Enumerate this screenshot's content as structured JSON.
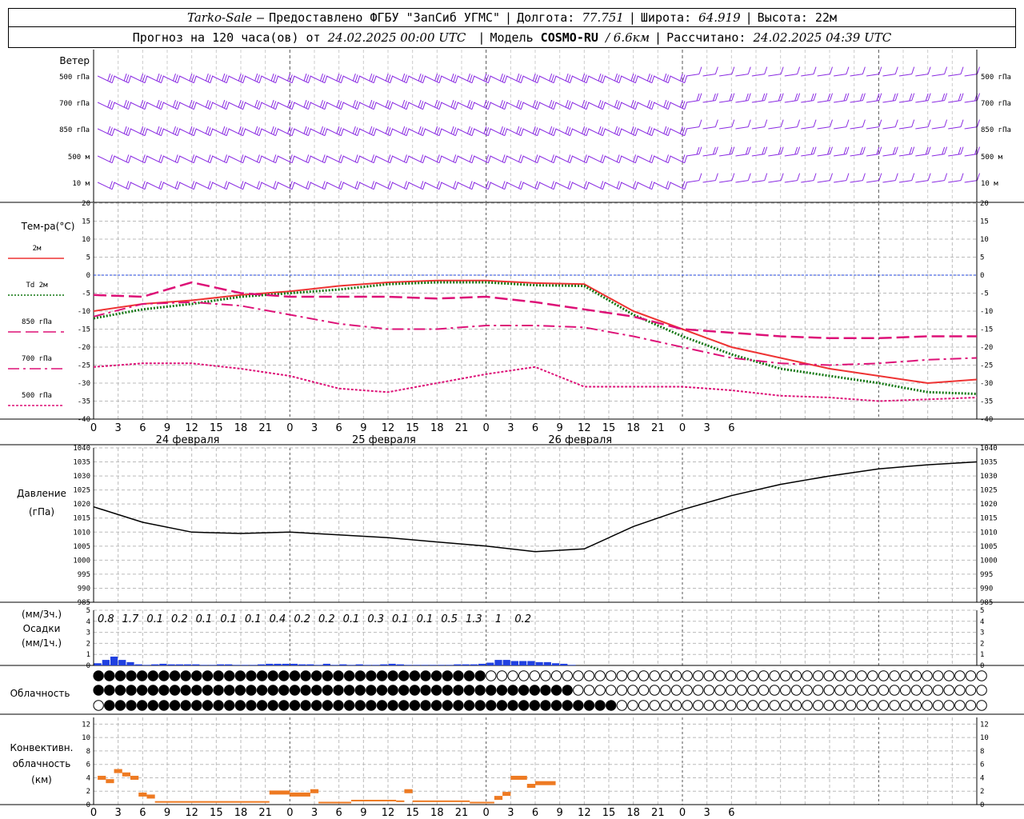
{
  "header": {
    "station": "Tarko-Sale",
    "dash": "–",
    "provider": "Предоставлено ФГБУ \"ЗапСиб УГМС\"",
    "lon_label": "Долгота:",
    "lon": "77.751",
    "lat_label": "Широта:",
    "lat": "64.919",
    "alt_label": "Высота:",
    "alt": "22м",
    "forecast_prefix": "Прогноз на 120 часа(ов) от",
    "forecast_from": "24.02.2025 00:00 UTC",
    "model_label": "Модель",
    "model": "COSMO-RU",
    "resolution": "/ 6.6км",
    "calc_label": "Рассчитано:",
    "calc_time": "24.02.2025 04:39 UTC"
  },
  "wind_panel": {
    "title": "Ветер",
    "levels": [
      "500 гПа",
      "700 гПа",
      "850 гПа",
      "500 м",
      "10  м"
    ]
  },
  "temp_panel": {
    "title": "Тем-ра(°С)",
    "legend": [
      {
        "label": "2м",
        "color": "#ee3333",
        "style": "solid"
      },
      {
        "label": "Td  2м",
        "color": "#117711",
        "style": "dotted"
      },
      {
        "label": "850 гПа",
        "color": "#dd1177",
        "style": "long-dash"
      },
      {
        "label": "700 гПа",
        "color": "#dd1177",
        "style": "dash-dot"
      },
      {
        "label": "500 гПа",
        "color": "#dd1177",
        "style": "short-dot"
      }
    ]
  },
  "pressure_panel": {
    "title": "Давление",
    "unit": "(гПа)"
  },
  "precip_panel": {
    "unit3h": "(мм/3ч.)",
    "title": "Осадки",
    "unit1h": "(мм/1ч.)",
    "totals": [
      "0.8",
      "1.7",
      "0.1",
      "0.2",
      "0.1",
      "0.1",
      "0.1",
      "0.4",
      "0.2",
      "0.2",
      "0.1",
      "0.3",
      "0.1",
      "0.1",
      "0.5",
      "1.3",
      "1",
      "0.2"
    ]
  },
  "cloud_panel": {
    "title": "Облачность"
  },
  "conv_panel": {
    "title": "Конвективн.",
    "title2": "облачность",
    "unit": "(км)"
  },
  "x_axis": {
    "hour_labels": [
      "0",
      "3",
      "6",
      "9",
      "12",
      "15",
      "18",
      "21",
      "0",
      "3",
      "6",
      "9",
      "12",
      "15",
      "18",
      "21",
      "0",
      "3",
      "6",
      "9",
      "12",
      "15",
      "18",
      "21",
      "0",
      "3",
      "6"
    ],
    "days": [
      "24 февраля",
      "25 февраля",
      "26 февраля"
    ]
  },
  "chart_data": [
    {
      "type": "line",
      "title": "Тем-ра(°С)",
      "x_hours": [
        0,
        6,
        12,
        18,
        24,
        30,
        36,
        42,
        48,
        54,
        60,
        66,
        72,
        78,
        84,
        90,
        96,
        102,
        108
      ],
      "ylim": [
        -40,
        20
      ],
      "yticks": [
        20,
        15,
        10,
        5,
        0,
        -5,
        -10,
        -15,
        -20,
        -25,
        -30,
        -35,
        -40
      ],
      "series": [
        {
          "name": "2м",
          "values": [
            -10,
            -8,
            -7,
            -5.5,
            -4.5,
            -3,
            -2,
            -1.5,
            -1.5,
            -2.2,
            -2.5,
            -10,
            -15,
            -20,
            -23,
            -26,
            -28,
            -30,
            -29
          ]
        },
        {
          "name": "Td  2м",
          "values": [
            -12,
            -9.5,
            -8,
            -6,
            -5,
            -4,
            -2.5,
            -2,
            -2,
            -2.8,
            -3,
            -11,
            -17,
            -22,
            -26,
            -28,
            -30,
            -32.5,
            -33
          ]
        },
        {
          "name": "850 гПа",
          "values": [
            -5.5,
            -6,
            -2,
            -5,
            -6,
            -6,
            -6,
            -6.5,
            -6,
            -7.5,
            -9.5,
            -11.5,
            -15,
            -16,
            -17,
            -17.5,
            -17.5,
            -17,
            -17
          ]
        },
        {
          "name": "700 гПа",
          "values": [
            -11.5,
            -8,
            -7.5,
            -8.5,
            -11,
            -13.5,
            -15,
            -15,
            -14,
            -14,
            -14.5,
            -17,
            -20,
            -23,
            -24.5,
            -25,
            -24.5,
            -23.5,
            -23
          ]
        },
        {
          "name": "500 гПа",
          "values": [
            -25.5,
            -24.5,
            -24.5,
            -26,
            -28,
            -31.5,
            -32.5,
            -30,
            -27.5,
            -25.5,
            -31,
            -31,
            -31,
            -32,
            -33.5,
            -34,
            -35,
            -34.5,
            -34
          ]
        }
      ]
    },
    {
      "type": "line",
      "title": "Давление",
      "x_hours": [
        0,
        6,
        12,
        18,
        24,
        30,
        36,
        42,
        48,
        54,
        60,
        66,
        72,
        78,
        84,
        90,
        96,
        102,
        108
      ],
      "ylim": [
        985,
        1040
      ],
      "yticks": [
        1040,
        1035,
        1030,
        1025,
        1020,
        1015,
        1010,
        1005,
        1000,
        995,
        990,
        985
      ],
      "series": [
        {
          "name": "",
          "values": [
            1019,
            1013.5,
            1010,
            1009.5,
            1010,
            1009,
            1008,
            1006.5,
            1005,
            1003,
            1004,
            1012,
            1018,
            1023,
            1027,
            1030,
            1032.5,
            1034,
            1035
          ]
        }
      ]
    },
    {
      "type": "bar",
      "title": "Осадки",
      "ylim": [
        0,
        5
      ],
      "yticks": [
        5,
        4,
        3,
        2,
        1,
        0
      ],
      "x_hours": [
        1,
        2,
        3,
        4,
        5,
        6,
        7,
        8,
        9,
        10,
        11,
        12,
        13,
        14,
        15,
        16,
        17,
        18,
        19,
        20,
        21,
        22,
        23,
        24,
        25,
        26,
        27,
        28,
        29,
        30,
        31,
        32,
        33,
        34,
        35,
        36,
        37,
        38,
        39,
        40,
        41,
        42,
        43,
        44,
        45,
        46,
        47,
        48,
        49,
        50,
        51,
        52,
        53,
        54,
        55,
        56,
        57,
        58,
        59,
        60,
        61,
        62,
        63,
        64,
        65,
        66,
        67
      ],
      "values": [
        0.2,
        0.5,
        0.8,
        0.5,
        0.3,
        0.1,
        0.05,
        0.1,
        0.15,
        0.1,
        0.1,
        0.1,
        0.1,
        0.05,
        0.05,
        0.1,
        0.1,
        0.05,
        0.05,
        0.05,
        0.1,
        0.15,
        0.15,
        0.15,
        0.15,
        0.1,
        0.1,
        0.05,
        0.15,
        0.05,
        0.1,
        0.05,
        0.1,
        0.05,
        0.05,
        0.1,
        0.15,
        0.1,
        0.05,
        0.05,
        0.05,
        0.05,
        0.05,
        0.05,
        0.1,
        0.1,
        0.1,
        0.15,
        0.25,
        0.5,
        0.5,
        0.4,
        0.4,
        0.4,
        0.3,
        0.3,
        0.2,
        0.15,
        0.05,
        0,
        0,
        0,
        0,
        0,
        0,
        0,
        0
      ]
    },
    {
      "type": "bar",
      "title": "Конвективн. облачность",
      "ylim": [
        0,
        13
      ],
      "yticks": [
        12,
        10,
        8,
        6,
        4,
        2,
        0
      ],
      "segments": [
        {
          "from": 0.5,
          "to": 1.5,
          "value": 4
        },
        {
          "from": 1.5,
          "to": 2.5,
          "value": 3.5
        },
        {
          "from": 2.5,
          "to": 3.5,
          "value": 5
        },
        {
          "from": 3.5,
          "to": 4.5,
          "value": 4.5
        },
        {
          "from": 4.5,
          "to": 5.5,
          "value": 4
        },
        {
          "from": 5.5,
          "to": 6.5,
          "value": 1.5
        },
        {
          "from": 6.5,
          "to": 7.5,
          "value": 1.2
        },
        {
          "from": 7.5,
          "to": 21.5,
          "value": 0.4
        },
        {
          "from": 21.5,
          "to": 24,
          "value": 1.8
        },
        {
          "from": 24,
          "to": 26.5,
          "value": 1.5
        },
        {
          "from": 26.5,
          "to": 27.5,
          "value": 2
        },
        {
          "from": 27.5,
          "to": 31.5,
          "value": 0.3
        },
        {
          "from": 31.5,
          "to": 37,
          "value": 0.6
        },
        {
          "from": 37,
          "to": 38,
          "value": 0.5
        },
        {
          "from": 38,
          "to": 39,
          "value": 2
        },
        {
          "from": 39,
          "to": 46,
          "value": 0.5
        },
        {
          "from": 46,
          "to": 49,
          "value": 0.3
        },
        {
          "from": 49,
          "to": 50,
          "value": 1
        },
        {
          "from": 50,
          "to": 51,
          "value": 1.6
        },
        {
          "from": 51,
          "to": 53,
          "value": 4
        },
        {
          "from": 53,
          "to": 54,
          "value": 2.8
        },
        {
          "from": 54,
          "to": 56.5,
          "value": 3.2
        }
      ]
    }
  ]
}
